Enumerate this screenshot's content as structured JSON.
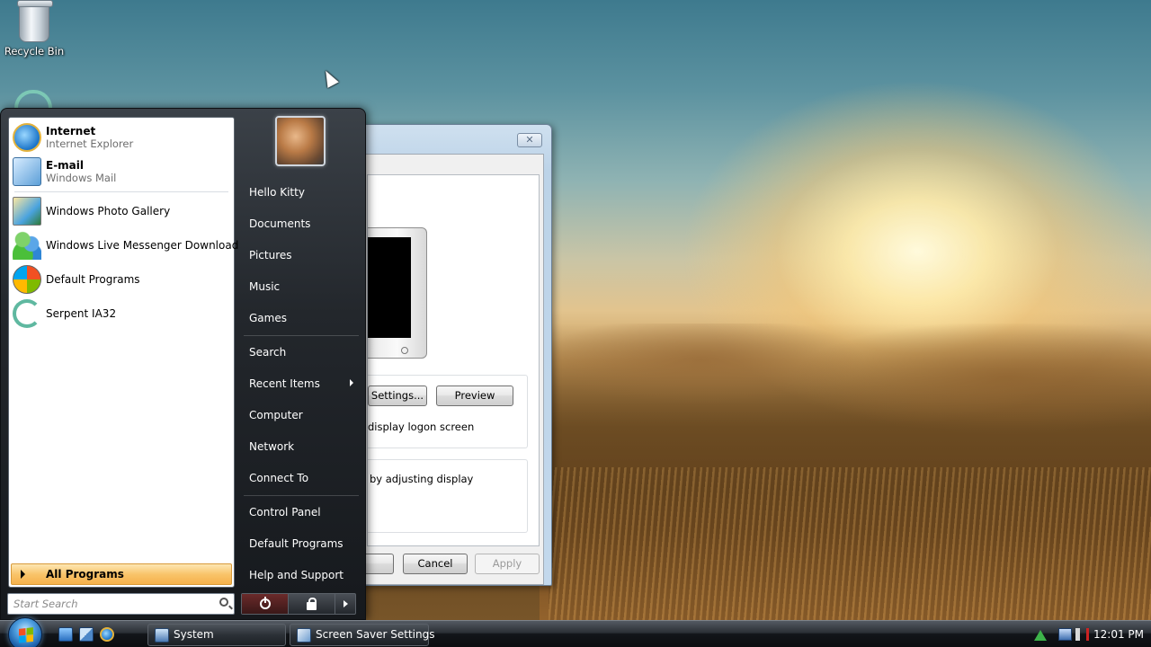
{
  "desktop": {
    "recycle_bin_label": "Recycle Bin"
  },
  "dialog": {
    "close_glyph": "✕",
    "settings_button": "Settings...",
    "preview_button": "Preview",
    "logon_text": "display logon screen",
    "power_text": "by adjusting display",
    "ok_button": "",
    "cancel_button": "Cancel",
    "apply_button": "Apply"
  },
  "start_menu": {
    "pinned": [
      {
        "title": "Internet",
        "subtitle": "Internet Explorer",
        "icon": "internet-explorer-icon"
      },
      {
        "title": "E-mail",
        "subtitle": "Windows Mail",
        "icon": "windows-mail-icon"
      }
    ],
    "recent": [
      {
        "title": "Windows Photo Gallery",
        "icon": "photo-gallery-icon"
      },
      {
        "title": "Windows Live Messenger Download",
        "icon": "messenger-icon"
      },
      {
        "title": "Default Programs",
        "icon": "default-programs-icon"
      },
      {
        "title": "Serpent IA32",
        "icon": "serpent-icon"
      }
    ],
    "all_programs": "All Programs",
    "search_placeholder": "Start Search",
    "right_items": [
      "Hello Kitty",
      "Documents",
      "Pictures",
      "Music",
      "Games",
      "Search",
      "Recent Items",
      "Computer",
      "Network",
      "Connect To",
      "Control Panel",
      "Default Programs",
      "Help and Support"
    ]
  },
  "taskbar": {
    "buttons": [
      {
        "label": "System",
        "icon": "system-icon"
      },
      {
        "label": "Screen Saver Settings",
        "icon": "screen-saver-icon"
      }
    ],
    "clock": "12:01 PM"
  },
  "colors": {
    "all_programs_highlight": "#f9c46a",
    "taskbar_bg": "#1c2025",
    "start_menu_bg": "#23272c"
  }
}
